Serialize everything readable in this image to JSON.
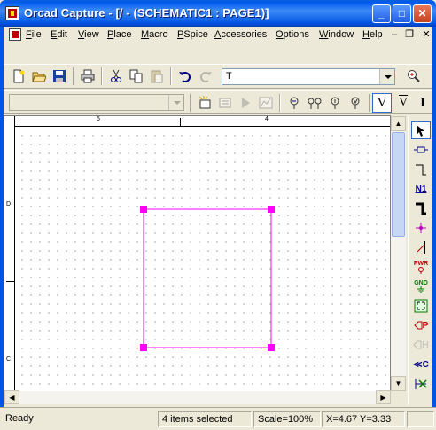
{
  "window": {
    "title": "Orcad Capture - [/ - (SCHEMATIC1 : PAGE1)]",
    "min_glyph": "_",
    "max_glyph": "□",
    "close_glyph": "✕"
  },
  "menu": {
    "items": [
      "File",
      "Edit",
      "View",
      "Place",
      "Macro",
      "PSpice",
      "Accessories",
      "Options",
      "Window",
      "Help"
    ],
    "mdi_min": "–",
    "mdi_restore": "❐",
    "mdi_close": "✕"
  },
  "toolbar": {
    "part_combo_value": "T",
    "part_combo_placeholder": "",
    "sim_profile_combo_value": "",
    "v_marker": "V",
    "vdiff_marker": "V",
    "i_marker": "I"
  },
  "ruler": {
    "top_labels": [
      "5",
      "4"
    ],
    "left_labels": [
      "D",
      "C"
    ]
  },
  "selection": {
    "shape": "rectangle",
    "color": "#ff00ff",
    "handle_color": "#ff00ff"
  },
  "palette": {
    "items": [
      {
        "icon": "select-arrow-icon"
      },
      {
        "icon": "place-part-icon"
      },
      {
        "icon": "place-wire-icon"
      },
      {
        "icon": "place-net-alias-icon",
        "label": "N1"
      },
      {
        "icon": "place-bus-icon"
      },
      {
        "icon": "place-junction-icon"
      },
      {
        "icon": "place-bus-entry-icon"
      },
      {
        "icon": "place-power-icon",
        "label": "PWR"
      },
      {
        "icon": "place-ground-icon",
        "label": "GND"
      },
      {
        "icon": "place-hierarchical-block-icon"
      },
      {
        "icon": "place-port-icon",
        "label": "P"
      },
      {
        "icon": "place-hier-pin-icon",
        "label": "H"
      },
      {
        "icon": "place-off-page-connector-icon",
        "label": "C"
      },
      {
        "icon": "place-no-connect-icon"
      }
    ]
  },
  "status": {
    "ready": "Ready",
    "selection": "4 items selected",
    "scale": "Scale=100%",
    "coords": "X=4.67  Y=3.33"
  },
  "colors": {
    "titlebar": "#0058ee",
    "chrome": "#ece9d8",
    "selection": "#ff00ff"
  }
}
